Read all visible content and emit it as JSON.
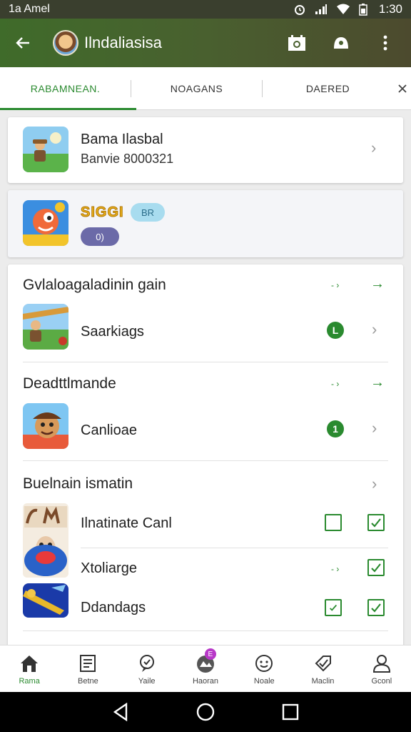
{
  "status_bar": {
    "carrier": "1a Amel",
    "time": "1:30"
  },
  "app_bar": {
    "title": "Ilndaliasisa"
  },
  "tabs": [
    {
      "label": "RABAMNEAN."
    },
    {
      "label": "NOAGANS"
    },
    {
      "label": "DAERED"
    }
  ],
  "card1": {
    "name": "Bama Ilasbal",
    "subtitle": "Banvie 8000321"
  },
  "card2": {
    "logo_text": "SIGGI",
    "pill1": "BR",
    "pill2": "0)"
  },
  "sections": [
    {
      "title": "Gvlaloagaladinin gain",
      "item": {
        "name": "Saarkiags",
        "badge": "L"
      }
    },
    {
      "title": "Deadttlmande",
      "item": {
        "name": "Canlioae",
        "badge": "1"
      }
    },
    {
      "title": "Buelnain ismatin",
      "items": [
        {
          "name": "Ilnatinate Canl"
        },
        {
          "name": "Xtoliarge"
        },
        {
          "name": "Ddandags"
        }
      ]
    }
  ],
  "bottom_nav": [
    {
      "label": "Rama",
      "icon": "home-icon",
      "active": true
    },
    {
      "label": "Betne",
      "icon": "list-icon"
    },
    {
      "label": "Yaile",
      "icon": "chat-icon"
    },
    {
      "label": "Haoran",
      "icon": "camera-icon",
      "badge": "E"
    },
    {
      "label": "Noale",
      "icon": "smile-icon"
    },
    {
      "label": "Maclin",
      "icon": "tag-icon"
    },
    {
      "label": "Gconl",
      "icon": "person-icon"
    }
  ],
  "colors": {
    "accent": "#2a8a2f",
    "appbar": "#49602f"
  }
}
